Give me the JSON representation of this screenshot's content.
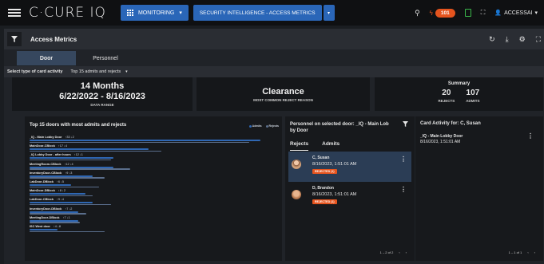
{
  "topbar": {
    "logo": "C·CURE IQ",
    "monitoring_label": "MONITORING",
    "security_label": "SECURITY INTELLIGENCE - ACCESS METRICS",
    "notification_count": "101",
    "user_label": "ACCESSAI"
  },
  "panel": {
    "title": "Access Metrics",
    "tabs": [
      "Door",
      "Personnel"
    ],
    "select_label": "Select type of card activity",
    "select_value": "Top 15 admits and rejects"
  },
  "stats": {
    "months": "14 Months",
    "date_range": "6/22/2022 - 8/16/2023",
    "date_caption": "DATA RANGE",
    "clearance": "Clearance",
    "clearance_caption": "MOST COMMON REJECT REASON",
    "summary_title": "Summary",
    "rejects_value": "20",
    "rejects_label": "REJECTS",
    "admits_value": "107",
    "admits_label": "ADMITS"
  },
  "chart_data": {
    "type": "bar",
    "title": "Top 15 doors with most admits and rejects",
    "legend": [
      {
        "name": "Admits",
        "color": "#2f67b3"
      },
      {
        "name": "Rejects",
        "color": "#5a6e8c"
      }
    ],
    "categories": [
      "_IQ - Main Lobby Door",
      "MainDoor-CBlock",
      "_IQ Lobby Door - after hours",
      "MeetingRoom-CBlock",
      "InventoryDoor-CBlock",
      "LabDoor-DBlock",
      "MainDoor-DBlock",
      "LabDoor-CBlock",
      "InventoryDoor-DBlock",
      "MeetingDoor-DBlock",
      "ISC West door"
    ],
    "series": [
      {
        "name": "Admits",
        "values": [
          33,
          17,
          12,
          12,
          9,
          6,
          8,
          9,
          7,
          7,
          4
        ]
      },
      {
        "name": "Rejects",
        "values": [
          2,
          4,
          1,
          4,
          3,
          5,
          2,
          4,
          2,
          1,
          8
        ]
      }
    ]
  },
  "personnel_card": {
    "title": "Personnel on selected door: _IQ - Main Lob by Door",
    "tabs": [
      "Rejects",
      "Admits"
    ],
    "entries": [
      {
        "name": "C, Susan",
        "time": "8/16/2023, 1:51:01 AM",
        "badge": "REJECTED (1)"
      },
      {
        "name": "D, Brandon",
        "time": "8/16/2023, 1:51:01 AM",
        "badge": "REJECTED (1)"
      }
    ],
    "pager": "1 – 2 of 2"
  },
  "activity_card": {
    "title": "Card Activity for: C, Susan",
    "door": "_IQ - Main Lobby Door",
    "time": "8/16/2023, 1:51:01 AM",
    "pager": "1 – 1 of 1"
  }
}
